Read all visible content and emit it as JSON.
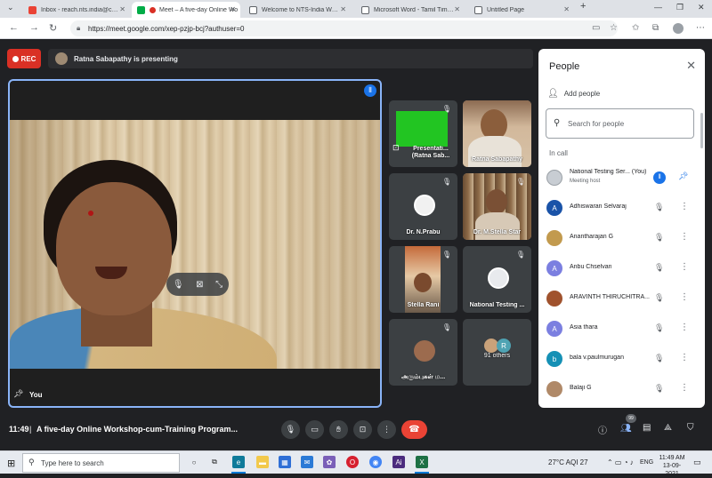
{
  "browser": {
    "tabs": [
      {
        "label": "Inbox - reach.nts.india@ciil-ntsin",
        "favicon": "gmail-icon",
        "color": "#ea4335",
        "active": false
      },
      {
        "label": "Meet – A five-day Online Wo",
        "favicon": "meet-icon",
        "color": "#00ac47",
        "active": true
      },
      {
        "label": "Welcome to NTS-India Website",
        "favicon": "page-icon",
        "color": "#5f6368",
        "active": false
      },
      {
        "label": "Microsoft Word - Tamil Time Tab",
        "favicon": "page-icon",
        "color": "#5f6368",
        "active": false
      },
      {
        "label": "Untitled Page",
        "favicon": "page-icon",
        "color": "#5f6368",
        "active": false
      }
    ],
    "url": "https://meet.google.com/xep-pzjp-bcj?authuser=0"
  },
  "meet": {
    "rec_label": "REC",
    "presenting_text": "Ratna Sabapathy is presenting",
    "main_tile_name": "You",
    "tiles": [
      {
        "name": "Presentati... (Ratna Sab..."
      },
      {
        "name": "Ratna Sabapathy"
      },
      {
        "name": "Dr. N.Prabu"
      },
      {
        "name": "Dr. M.Stella Star"
      },
      {
        "name": "Stella Rani"
      },
      {
        "name": "National Testing ..."
      },
      {
        "name": "அரும்புகள் ம..."
      },
      {
        "name": "91 others"
      }
    ],
    "others_avatar_letter": "R"
  },
  "people_panel": {
    "title": "People",
    "add_people_label": "Add people",
    "search_placeholder": "Search for people",
    "section_label": "In call",
    "participants": [
      {
        "name": "National Testing Ser... (You)",
        "subtitle": "Meeting host",
        "avatar_letter": "",
        "avatar_color": "#c8cdd3"
      },
      {
        "name": "Adhiswaran Selvaraj",
        "avatar_letter": "A",
        "avatar_color": "#1a53a8"
      },
      {
        "name": "Anantharajan G",
        "avatar_letter": "",
        "avatar_color": "#c29a4e"
      },
      {
        "name": "Anbu Chselvan",
        "avatar_letter": "A",
        "avatar_color": "#7b7fe0"
      },
      {
        "name": "ARAVINTH THIRUCHITRA...",
        "avatar_letter": "",
        "avatar_color": "#a0522d"
      },
      {
        "name": "Asia thara",
        "avatar_letter": "A",
        "avatar_color": "#7b7fe0"
      },
      {
        "name": "bala v.paulmurugan",
        "avatar_letter": "b",
        "avatar_color": "#1590b5"
      },
      {
        "name": "Balaji G",
        "avatar_letter": "",
        "avatar_color": "#b08968"
      }
    ]
  },
  "bottom_bar": {
    "time": "11:49",
    "separator": "|",
    "meeting_title": "A five-day Online Workshop-cum-Training Program...",
    "people_count": "99"
  },
  "taskbar": {
    "search_placeholder": "Type here to search",
    "weather": "27°C  AQI 27",
    "language": "ENG",
    "time": "11:49 AM",
    "date": "13-09-2021"
  }
}
